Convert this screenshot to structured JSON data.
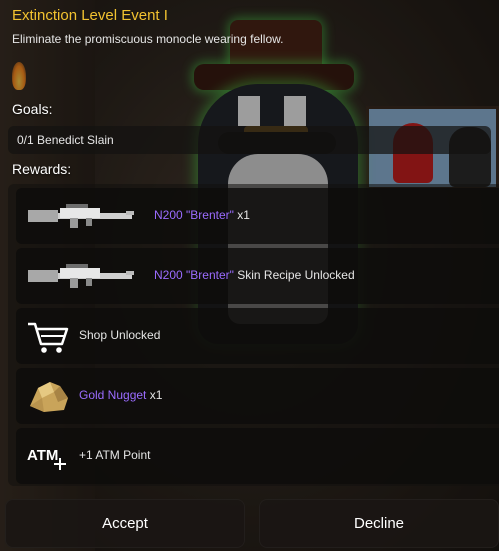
{
  "quest": {
    "title": "Extinction Level Event I",
    "description": "Eliminate the promiscuous monocle wearing fellow."
  },
  "goals": {
    "label": "Goals:",
    "items": [
      {
        "text": "0/1 Benedict Slain"
      }
    ]
  },
  "rewards": {
    "label": "Rewards:",
    "items": [
      {
        "icon": "rifle-icon",
        "name": "N200 \"Brenter\"",
        "suffix": " x1"
      },
      {
        "icon": "rifle-icon",
        "name": "N200 \"Brenter\"",
        "suffix": " Skin Recipe Unlocked"
      },
      {
        "icon": "shopping-cart-icon",
        "name": "",
        "suffix": "Shop Unlocked"
      },
      {
        "icon": "gold-nugget-icon",
        "name": "Gold Nugget",
        "suffix": " x1"
      },
      {
        "icon": "atm-plus-icon",
        "icon_text": "ATM",
        "name": "",
        "suffix": "+1 ATM Point"
      }
    ]
  },
  "buttons": {
    "accept": "Accept",
    "decline": "Decline"
  },
  "colors": {
    "title": "#f2c230",
    "item_name": "#9b6cff",
    "panel_bg": "rgba(14,12,11,0.82)"
  }
}
